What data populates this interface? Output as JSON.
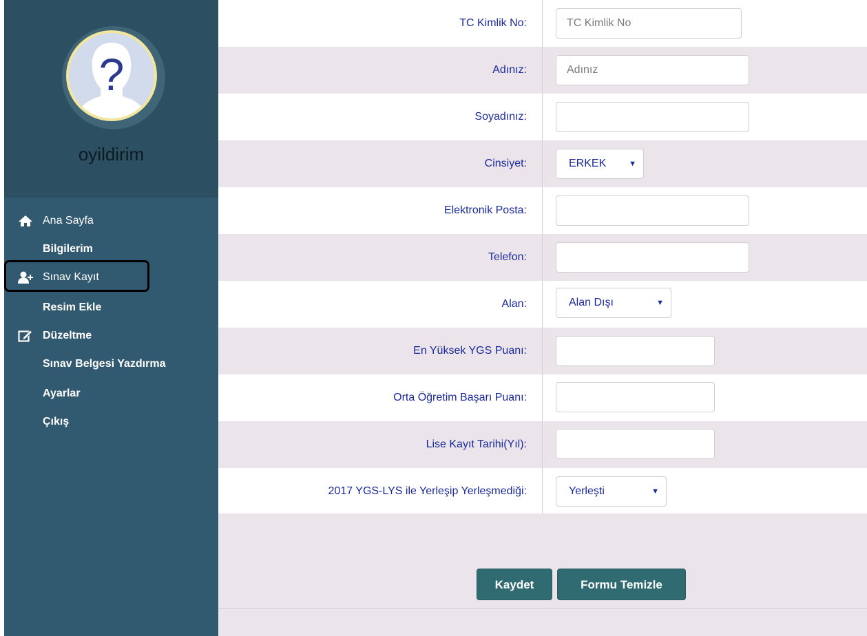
{
  "sidebar": {
    "username": "oyildirim",
    "items": [
      {
        "label": "Ana Sayfa",
        "icon": "home-icon"
      },
      {
        "label": "Bilgilerim",
        "icon": ""
      },
      {
        "label": "Sınav Kayıt",
        "icon": "add-user-icon"
      },
      {
        "label": "Resim Ekle",
        "icon": ""
      },
      {
        "label": "Düzeltme",
        "icon": "edit-icon"
      },
      {
        "label": "Sınav Belgesi Yazdırma",
        "icon": ""
      },
      {
        "label": "Ayarlar",
        "icon": ""
      },
      {
        "label": "Çıkış",
        "icon": ""
      }
    ]
  },
  "form": {
    "tc": {
      "label": "TC Kimlik No:",
      "placeholder": "TC Kimlik No"
    },
    "ad": {
      "label": "Adınız:",
      "placeholder": "Adınız"
    },
    "soyad": {
      "label": "Soyadınız:"
    },
    "cinsiyet": {
      "label": "Cinsiyet:",
      "value": "ERKEK"
    },
    "eposta": {
      "label": "Elektronik Posta:"
    },
    "telefon": {
      "label": "Telefon:"
    },
    "alan": {
      "label": "Alan:",
      "value": "Alan Dışı"
    },
    "ygs": {
      "label": "En Yüksek YGS Puanı:"
    },
    "obp": {
      "label": "Orta Öğretim Başarı Puanı:"
    },
    "lise": {
      "label": "Lise Kayıt Tarihi(Yıl):"
    },
    "yerlesme": {
      "label": "2017 YGS-LYS ile Yerleşip Yerleşmediği:",
      "value": "Yerleşti"
    },
    "save_label": "Kaydet",
    "clear_label": "Formu Temizle"
  },
  "colors": {
    "sidebar": "#31596f",
    "profile": "#2c4f62",
    "label_text": "#1b2a9a",
    "button": "#2f6b70",
    "row_alt": "#ebe4ea"
  }
}
